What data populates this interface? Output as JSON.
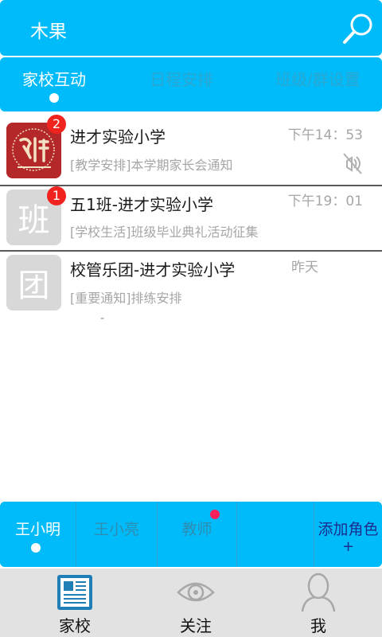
{
  "header": {
    "title": "木果"
  },
  "tabs": [
    {
      "label": "家校互动"
    },
    {
      "label": "日程安排"
    },
    {
      "label": "班级/群设置"
    }
  ],
  "messages": [
    {
      "title": "进才实验小学",
      "subtitle": "[教学安排]本学期家长会通知",
      "time": "下午14：53",
      "badge": "2",
      "muted": true
    },
    {
      "title": "五1班-进才实验小学",
      "subtitle": "[学校生活]班级毕业典礼活动征集",
      "time": "下午19：01",
      "badge": "1",
      "avatar_text": "班"
    },
    {
      "title": "校管乐团-进才实验小学",
      "subtitle": "[重要通知]排练安排",
      "time": "昨天",
      "avatar_text": "团"
    }
  ],
  "dash": "-",
  "roles": [
    {
      "label": "王小明"
    },
    {
      "label": "王小亮"
    },
    {
      "label": "教师"
    },
    {
      "label": ""
    },
    {
      "label": "添加角色",
      "extra": "+"
    }
  ],
  "bottom_nav": [
    {
      "label": "家校",
      "icon": "newspaper-icon"
    },
    {
      "label": "关注",
      "icon": "eye-icon"
    },
    {
      "label": "我",
      "icon": "person-icon"
    }
  ],
  "colors": {
    "primary": "#00bbf9",
    "badge": "#f0231f",
    "notify": "#ff1f5a",
    "nav_bg": "#e2e2e2"
  }
}
